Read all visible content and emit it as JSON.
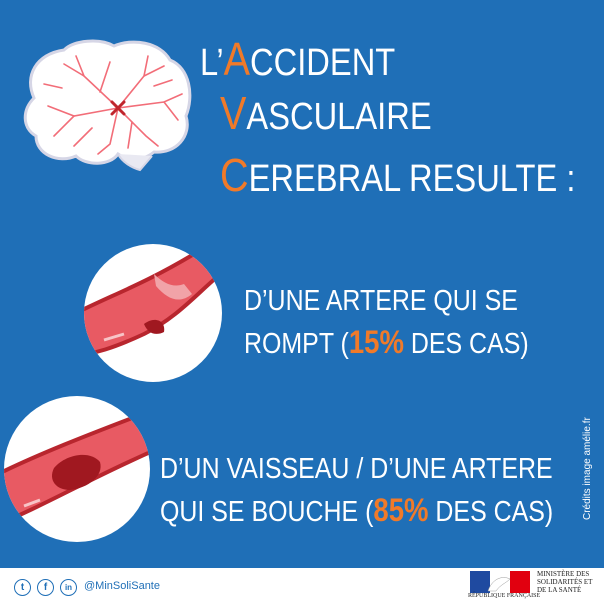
{
  "title": {
    "line1_prefix": "L’",
    "line1_letter": "A",
    "line1_rest": "CCIDENT",
    "line2_letter": "V",
    "line2_rest": "ASCULAIRE",
    "line3_letter": "C",
    "line3_rest": "EREBRAL RESULTE :"
  },
  "item1": {
    "line1": "D’UNE ARTERE QUI SE",
    "line2_before": "ROMPT (",
    "line2_pct": "15%",
    "line2_after": " DES CAS)"
  },
  "item2": {
    "line1": "D’UN VAISSEAU / D’UNE ARTERE",
    "line2_before": "QUI SE BOUCHE  (",
    "line2_pct": "85%",
    "line2_after": " DES CAS)"
  },
  "credits": "Crédits image amélie.fr",
  "footer": {
    "social_icons": [
      "twitter-icon",
      "facebook-icon",
      "linkedin-icon"
    ],
    "twitter_glyph": "t",
    "facebook_glyph": "f",
    "linkedin_glyph": "in",
    "handle": "@MinSoliSante",
    "ministry": "MINISTÈRE DES SOLIDARITÉS ET DE LA SANTÉ",
    "republic": "RÉPUBLIQUE FRANÇAISE",
    "motto": "Liberté • Égalité • Fraternité"
  },
  "colors": {
    "background": "#1f6fb7",
    "accent": "#f07a29",
    "text": "#ffffff"
  }
}
